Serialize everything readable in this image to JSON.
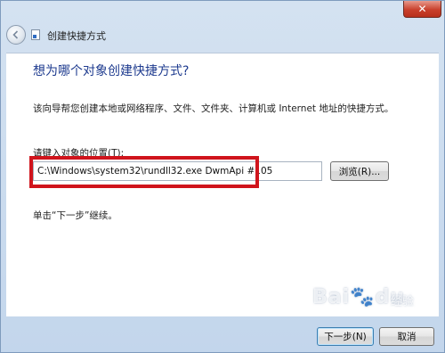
{
  "window": {
    "title": "创建快捷方式",
    "close_glyph": "✕"
  },
  "icons": {
    "back": "back-arrow-icon",
    "app": "shortcut-icon",
    "close": "close-icon"
  },
  "content": {
    "heading": "想为哪个对象创建快捷方式?",
    "description": "该向导帮您创建本地或网络程序、文件、文件夹、计算机或 Internet 地址的快捷方式。",
    "field_label": "请键入对象的位置(T):",
    "path_value": "C:\\Windows\\system32\\rundll32.exe DwmApi #105",
    "browse_label": "浏览(R)...",
    "hint": "单击“下一步”继续。"
  },
  "footer": {
    "next_label": "下一步(N)",
    "cancel_label": "取消"
  },
  "watermark": {
    "brand": "Bai",
    "brand_suffix": "du",
    "sub": "经验"
  },
  "colors": {
    "heading": "#1e3b8f",
    "highlight": "#d0141c",
    "close_button": "#c9402c"
  }
}
